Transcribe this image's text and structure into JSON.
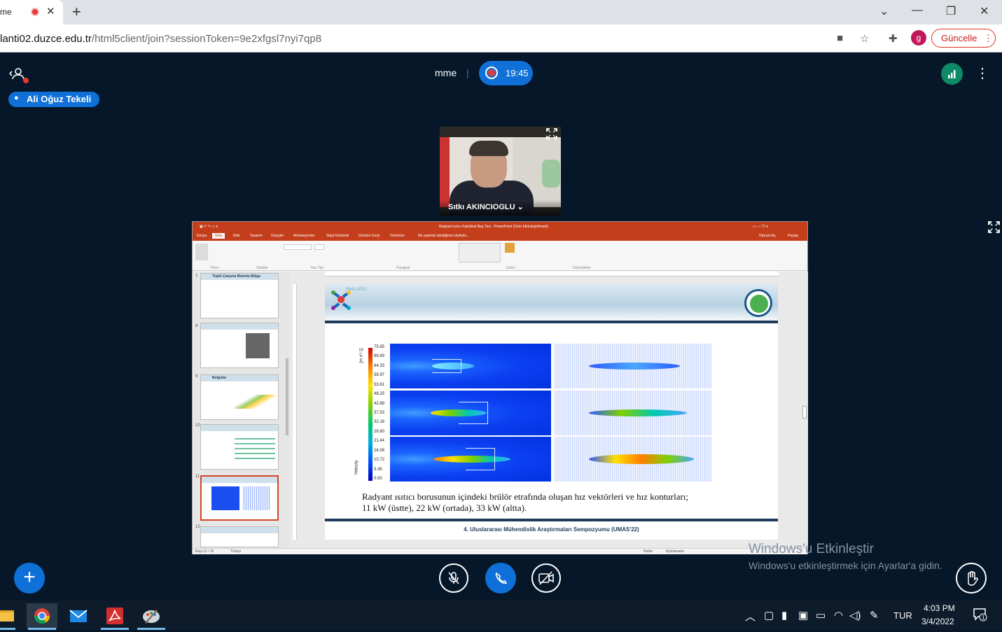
{
  "browser": {
    "tab_title": "me",
    "tab_close": "✕",
    "new_tab": "+",
    "url_host": "lanti02.duzce.edu.tr",
    "url_path": "/html5client/join?sessionToken=9e2xfgsl7nyi7qp8",
    "profile_initial": "g",
    "update_label": "Güncelle",
    "update_menu": "⋮",
    "window_controls": {
      "chevron": "⌄",
      "minimize": "—",
      "restore": "❐",
      "close": "✕"
    }
  },
  "meeting": {
    "name": "mme",
    "separator": "|",
    "recording_time": "19:45",
    "talker": "Ali Oğuz Tekeli",
    "webcam_name": "Sıtkı AKINCIOGLU ⌄",
    "more_menu": "⋮",
    "plus_label": "+",
    "colors": {
      "accent": "#0f70d7",
      "background": "#06172a",
      "connection": "#0f8a66",
      "record": "#e53935"
    }
  },
  "powerpoint": {
    "title_bar": "Radyant Isıtıcı Fakültesi Baş Yazı - PowerPoint (Ürün Etkinleştirilmedi)",
    "title_right": "Oturum Aç",
    "tabs": [
      "Dosya",
      "Giriş",
      "Ekle",
      "Tasarım",
      "Geçişler",
      "Animasyonlar",
      "Slayt Gösterisi",
      "Gözden Geçir",
      "Görünüm"
    ],
    "tell_me": "Ne yapmak istediğinizi söyleyin...",
    "share": "Paylaş",
    "ribbon_groups": [
      "Pano",
      "Slaytlar",
      "Yazı Tipi",
      "Paragraf",
      "Çizim",
      "Düzenleme"
    ],
    "thumb_numbers": [
      "7",
      "8",
      "9",
      "10",
      "11",
      "12"
    ],
    "thumb_titles": [
      "Tüplü Çalışma Motorlu Bölge",
      "",
      "Bulgular",
      "",
      "",
      ""
    ],
    "status_left": "Slayt 11 / 16",
    "status_lang": "Türkçe",
    "status_notes": "Notlar",
    "status_comments": "Açıklamalar"
  },
  "slide": {
    "event_label": "Peris-2022",
    "colorbar_unit": "[m s^-1]",
    "colorbar_var": "Velocity",
    "colorbar_ticks": [
      "75.65",
      "69.69",
      "64.33",
      "58.97",
      "53.61",
      "48.25",
      "42.89",
      "37.53",
      "32.16",
      "26.80",
      "21.44",
      "16.08",
      "10.72",
      "5.36",
      "0.00"
    ],
    "caption_line1": "Radyant ısıtıcı borusunun içindeki brülör etrafında oluşan hız vektörleri ve hız konturları;",
    "caption_line2": "11 kW (üstte), 22 kW (ortada), 33 kW (altta).",
    "footer": "4. Uluslararası Mühendislik Araştırmaları Sempozyumu (UMAS'22)"
  },
  "watermark": {
    "line1": "Windows'u Etkinleştir",
    "line2": "Windows'u etkinleştirmek için Ayarlar'a gidin."
  },
  "taskbar": {
    "apps": [
      "file-explorer-icon",
      "chrome-icon",
      "mail-icon",
      "acrobat-icon",
      "paint-icon"
    ],
    "lang": "TUR",
    "time": "4:03 PM",
    "date": "3/4/2022",
    "notifications": "1"
  },
  "icons": {
    "participants": "👤",
    "fullscreen": "⛶",
    "mic": "🎙",
    "phone": "✆",
    "camera_off": "▣",
    "hand": "✋"
  }
}
